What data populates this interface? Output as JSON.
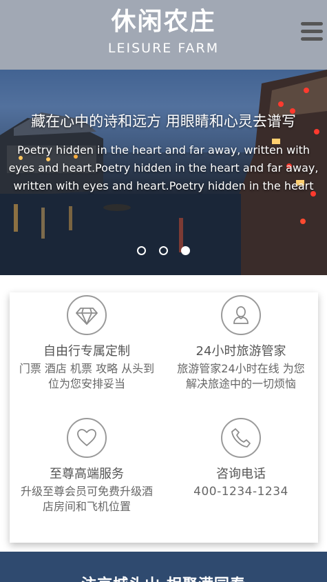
{
  "header": {
    "logo_cn": "休闲农庄",
    "logo_en": "LEISURE FARM",
    "menu_icon": "hamburger-menu-icon"
  },
  "banner": {
    "title": "藏在心中的诗和远方 用眼睛和心灵去谱写",
    "desc_lines": [
      "Poetry hidden in the heart and far away, written with",
      "eyes and heart.Poetry hidden in the heart and far away,",
      "written with eyes and heart.Poetry hidden in the heart"
    ],
    "slide_count": 3,
    "active_slide": 3
  },
  "services": [
    {
      "icon": "diamond-icon",
      "title": "自由行专属定制",
      "desc": "门票 酒店 机票 攻略 从头到位为您安排妥当"
    },
    {
      "icon": "user-icon",
      "title": "24小时旅游管家",
      "desc": "旅游管家24小时在线 为您解决旅途中的一切烦恼"
    },
    {
      "icon": "heart-icon",
      "title": "至尊高端服务",
      "desc": "升级至尊会员可免费升级酒店房间和飞机位置"
    },
    {
      "icon": "phone-icon",
      "title": "咨询电话",
      "desc": "400-1234-1234"
    }
  ],
  "bottom": {
    "text": "汴京城头山 相聚满园春"
  },
  "colors": {
    "header_bg": "#a1a8b4",
    "bottom_bg": "#2f4a6f",
    "icon_stroke": "#9a9a9a"
  }
}
